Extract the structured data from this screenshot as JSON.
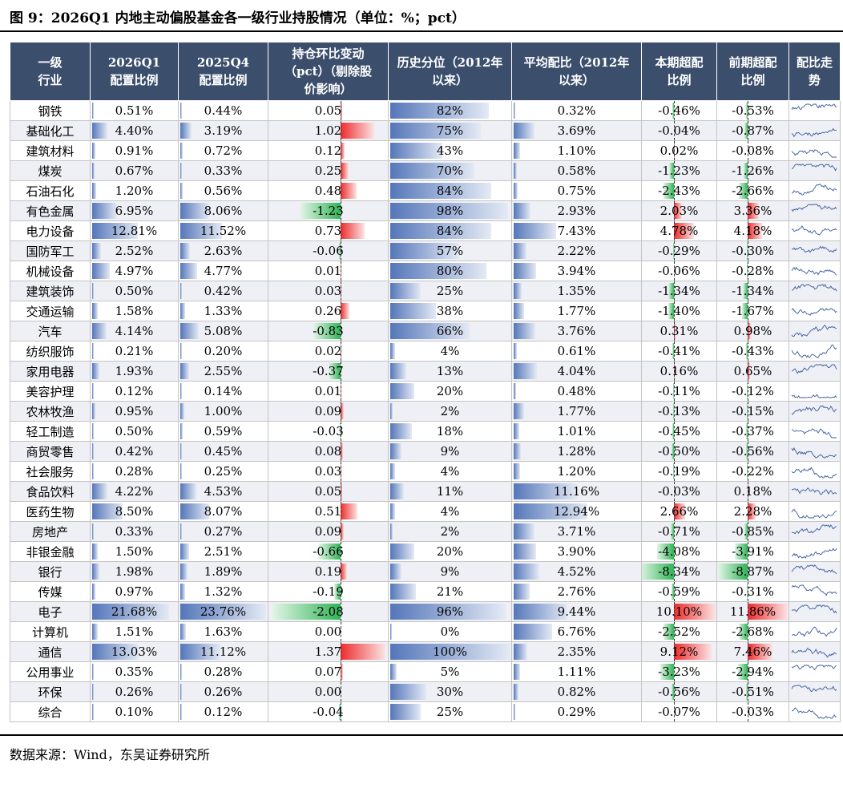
{
  "title": "图 9：2026Q1 内地主动偏股基金各一级行业持股情况（单位：%；pct）",
  "source": "数据来源：Wind，东吴证券研究所",
  "headers": [
    "一级\n行业",
    "2026Q1\n配置比例",
    "2025Q4\n配置比例",
    "持仓环比变动\n（pct）（剔除股\n价影响）",
    "历史分位（2012年\n以来）",
    "平均配比（2012年\n以来）",
    "本期超配\n比例",
    "前期超配\n比例",
    "配比走\n势"
  ],
  "accent": "#3b4f6d",
  "rows": [
    {
      "industry": "钢铁",
      "q1": "0.51%",
      "q4": "0.44%",
      "chg": "0.05",
      "pct": "82%",
      "avg": "0.32%",
      "over": "-0.46%",
      "prev": "-0.53%"
    },
    {
      "industry": "基础化工",
      "q1": "4.40%",
      "q4": "3.19%",
      "chg": "1.02",
      "pct": "75%",
      "avg": "3.69%",
      "over": "-0.04%",
      "prev": "-0.87%"
    },
    {
      "industry": "建筑材料",
      "q1": "0.91%",
      "q4": "0.72%",
      "chg": "0.12",
      "pct": "43%",
      "avg": "1.10%",
      "over": "0.02%",
      "prev": "-0.08%"
    },
    {
      "industry": "煤炭",
      "q1": "0.67%",
      "q4": "0.33%",
      "chg": "0.25",
      "pct": "70%",
      "avg": "0.58%",
      "over": "-1.23%",
      "prev": "-1.26%"
    },
    {
      "industry": "石油石化",
      "q1": "1.20%",
      "q4": "0.56%",
      "chg": "0.48",
      "pct": "84%",
      "avg": "0.75%",
      "over": "-2.43%",
      "prev": "-2.66%"
    },
    {
      "industry": "有色金属",
      "q1": "6.95%",
      "q4": "8.06%",
      "chg": "-1.23",
      "pct": "98%",
      "avg": "2.93%",
      "over": "2.03%",
      "prev": "3.36%"
    },
    {
      "industry": "电力设备",
      "q1": "12.81%",
      "q4": "11.52%",
      "chg": "0.73",
      "pct": "84%",
      "avg": "7.43%",
      "over": "4.78%",
      "prev": "4.18%"
    },
    {
      "industry": "国防军工",
      "q1": "2.52%",
      "q4": "2.63%",
      "chg": "-0.06",
      "pct": "57%",
      "avg": "2.22%",
      "over": "-0.29%",
      "prev": "-0.30%"
    },
    {
      "industry": "机械设备",
      "q1": "4.97%",
      "q4": "4.77%",
      "chg": "0.01",
      "pct": "80%",
      "avg": "3.94%",
      "over": "-0.06%",
      "prev": "-0.28%"
    },
    {
      "industry": "建筑装饰",
      "q1": "0.50%",
      "q4": "0.42%",
      "chg": "0.03",
      "pct": "25%",
      "avg": "1.35%",
      "over": "-1.34%",
      "prev": "-1.34%"
    },
    {
      "industry": "交通运输",
      "q1": "1.58%",
      "q4": "1.33%",
      "chg": "0.26",
      "pct": "38%",
      "avg": "1.77%",
      "over": "-1.40%",
      "prev": "-1.67%"
    },
    {
      "industry": "汽车",
      "q1": "4.14%",
      "q4": "5.08%",
      "chg": "-0.83",
      "pct": "66%",
      "avg": "3.76%",
      "over": "0.31%",
      "prev": "0.98%"
    },
    {
      "industry": "纺织服饰",
      "q1": "0.21%",
      "q4": "0.20%",
      "chg": "0.02",
      "pct": "4%",
      "avg": "0.61%",
      "over": "-0.41%",
      "prev": "-0.43%"
    },
    {
      "industry": "家用电器",
      "q1": "1.93%",
      "q4": "2.55%",
      "chg": "-0.37",
      "pct": "13%",
      "avg": "4.04%",
      "over": "0.16%",
      "prev": "0.65%"
    },
    {
      "industry": "美容护理",
      "q1": "0.12%",
      "q4": "0.14%",
      "chg": "0.01",
      "pct": "20%",
      "avg": "0.48%",
      "over": "-0.11%",
      "prev": "-0.12%"
    },
    {
      "industry": "农林牧渔",
      "q1": "0.95%",
      "q4": "1.00%",
      "chg": "0.09",
      "pct": "2%",
      "avg": "1.77%",
      "over": "-0.13%",
      "prev": "-0.15%"
    },
    {
      "industry": "轻工制造",
      "q1": "0.50%",
      "q4": "0.59%",
      "chg": "-0.03",
      "pct": "18%",
      "avg": "1.01%",
      "over": "-0.45%",
      "prev": "-0.37%"
    },
    {
      "industry": "商贸零售",
      "q1": "0.42%",
      "q4": "0.45%",
      "chg": "0.08",
      "pct": "9%",
      "avg": "1.28%",
      "over": "-0.50%",
      "prev": "-0.56%"
    },
    {
      "industry": "社会服务",
      "q1": "0.28%",
      "q4": "0.25%",
      "chg": "0.03",
      "pct": "4%",
      "avg": "1.20%",
      "over": "-0.19%",
      "prev": "-0.22%"
    },
    {
      "industry": "食品饮料",
      "q1": "4.22%",
      "q4": "4.53%",
      "chg": "0.05",
      "pct": "11%",
      "avg": "11.16%",
      "over": "-0.03%",
      "prev": "0.18%"
    },
    {
      "industry": "医药生物",
      "q1": "8.50%",
      "q4": "8.07%",
      "chg": "0.51",
      "pct": "4%",
      "avg": "12.94%",
      "over": "2.66%",
      "prev": "2.28%"
    },
    {
      "industry": "房地产",
      "q1": "0.33%",
      "q4": "0.27%",
      "chg": "0.09",
      "pct": "2%",
      "avg": "3.71%",
      "over": "-0.71%",
      "prev": "-0.85%"
    },
    {
      "industry": "非银金融",
      "q1": "1.50%",
      "q4": "2.51%",
      "chg": "-0.66",
      "pct": "20%",
      "avg": "3.90%",
      "over": "-4.08%",
      "prev": "-3.91%"
    },
    {
      "industry": "银行",
      "q1": "1.98%",
      "q4": "1.89%",
      "chg": "0.19",
      "pct": "9%",
      "avg": "4.52%",
      "over": "-8.34%",
      "prev": "-8.87%"
    },
    {
      "industry": "传媒",
      "q1": "0.97%",
      "q4": "1.32%",
      "chg": "-0.19",
      "pct": "21%",
      "avg": "2.76%",
      "over": "-0.59%",
      "prev": "-0.31%"
    },
    {
      "industry": "电子",
      "q1": "21.68%",
      "q4": "23.76%",
      "chg": "-2.08",
      "pct": "96%",
      "avg": "9.44%",
      "over": "10.10%",
      "prev": "11.86%"
    },
    {
      "industry": "计算机",
      "q1": "1.51%",
      "q4": "1.63%",
      "chg": "0.00",
      "pct": "0%",
      "avg": "6.76%",
      "over": "-2.52%",
      "prev": "-2.68%"
    },
    {
      "industry": "通信",
      "q1": "13.03%",
      "q4": "11.12%",
      "chg": "1.37",
      "pct": "100%",
      "avg": "2.35%",
      "over": "9.12%",
      "prev": "7.46%"
    },
    {
      "industry": "公用事业",
      "q1": "0.35%",
      "q4": "0.28%",
      "chg": "0.07",
      "pct": "5%",
      "avg": "1.11%",
      "over": "-3.23%",
      "prev": "-2.94%"
    },
    {
      "industry": "环保",
      "q1": "0.26%",
      "q4": "0.26%",
      "chg": "0.00",
      "pct": "30%",
      "avg": "0.82%",
      "over": "-0.56%",
      "prev": "-0.51%"
    },
    {
      "industry": "综合",
      "q1": "0.10%",
      "q4": "0.12%",
      "chg": "-0.04",
      "pct": "25%",
      "avg": "0.29%",
      "over": "-0.07%",
      "prev": "-0.03%"
    }
  ]
}
